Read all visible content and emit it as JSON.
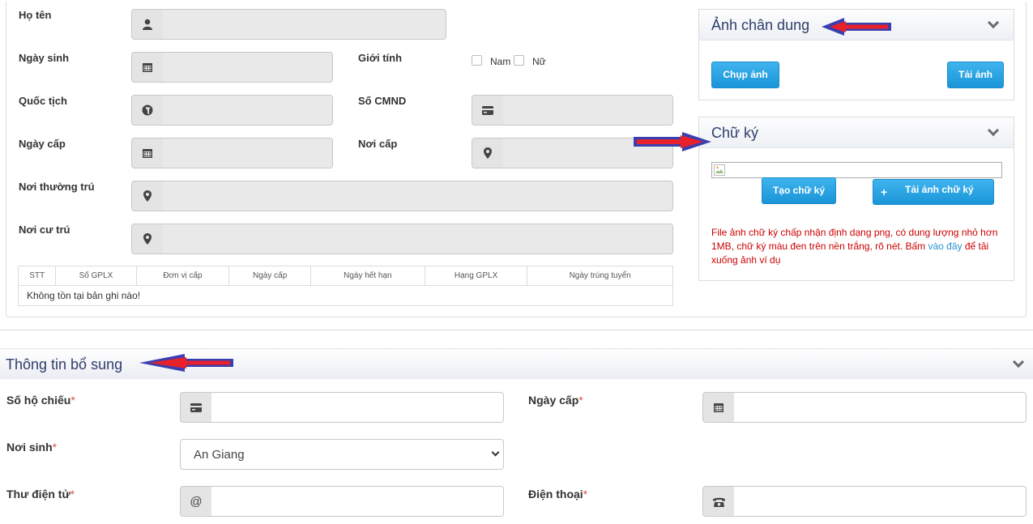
{
  "personal": {
    "ho_ten_label": "Họ tên",
    "ngay_sinh_label": "Ngày sinh",
    "gioi_tinh_label": "Giới tính",
    "gender_male": "Nam",
    "gender_female": "Nữ",
    "quoc_tich_label": "Quốc tịch",
    "so_cmnd_label": "Số CMND",
    "ngay_cap_label": "Ngày cấp",
    "noi_cap_label": "Nơi cấp",
    "noi_thuong_tru_label": "Nơi thường trú",
    "noi_cu_tru_label": "Nơi cư trú"
  },
  "license_table": {
    "columns": [
      "STT",
      "Số GPLX",
      "Đơn vị cấp",
      "Ngày cấp",
      "Ngày hết hạn",
      "Hạng GPLX",
      "Ngày trúng tuyển"
    ],
    "empty_text": "Không tồn tại bản ghi nào!"
  },
  "portrait_panel": {
    "title": "Ảnh chân dung",
    "capture_button": "Chụp ảnh",
    "upload_button": "Tải ảnh"
  },
  "signature_panel": {
    "title": "Chữ ký",
    "create_button": "Tạo chữ ký",
    "upload_button": "Tải ảnh chữ ký",
    "note_before": "File ảnh chữ ký chấp nhận định dạng png, có dung lượng nhỏ hơn 1MB, chữ ký màu đen trên nền trắng, rõ nét. Bấm ",
    "note_link": "vào đây",
    "note_after": " để tải xuống ảnh ví dụ"
  },
  "extra_section": {
    "title": "Thông tin bổ sung",
    "passport_label": "Số hộ chiếu",
    "issue_date_label": "Ngày cấp",
    "birthplace_label": "Nơi sinh",
    "birthplace_value": "An Giang",
    "email_label": "Thư điện tử",
    "email_addon": "@",
    "phone_label": "Điện thoại",
    "required_mark": "*"
  },
  "colors": {
    "accent_button": "#1a95d8",
    "panel_title": "#2f3e6b",
    "note_text": "#cc0000",
    "link": "#2a8fd0",
    "arrow_outline": "#3a3fb0",
    "arrow_fill": "#e8212a"
  },
  "icons": {
    "user": "user-icon",
    "calendar": "calendar-icon",
    "globe": "globe-icon",
    "card": "id-card-icon",
    "pin": "map-marker-icon",
    "phone": "phone-icon",
    "chevron": "chevron-down-icon",
    "plus": "plus-icon"
  }
}
